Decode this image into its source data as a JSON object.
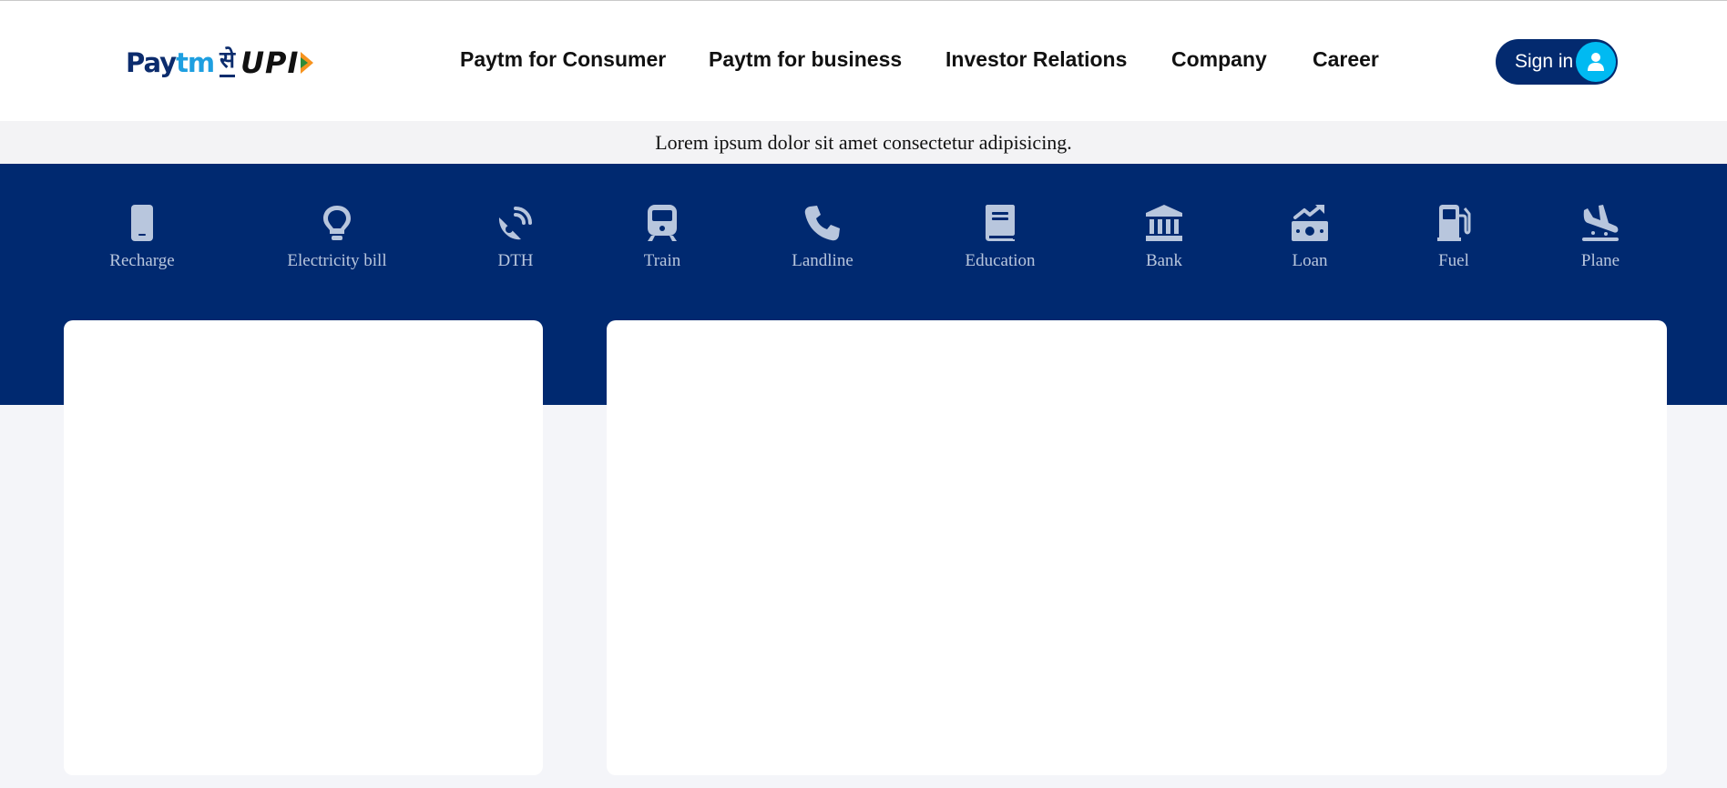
{
  "logo": {
    "paytm_pay": "Pay",
    "paytm_tm": "tm",
    "se": "से",
    "upi": "UPI",
    "colors": {
      "navy": "#0c2c6d",
      "sky": "#1e9fe0"
    }
  },
  "nav": {
    "items": [
      {
        "label": "Paytm for Consumer"
      },
      {
        "label": "Paytm for business"
      },
      {
        "label": "Investor Relations"
      },
      {
        "label": "Company"
      },
      {
        "label": "Career"
      }
    ],
    "signin_label": "Sign in"
  },
  "notice": {
    "text": "Lorem ipsum dolor sit amet consectetur adipisicing."
  },
  "services": {
    "items": [
      {
        "label": "Recharge",
        "icon": "mobile-icon"
      },
      {
        "label": "Electricity bill",
        "icon": "lightbulb-icon"
      },
      {
        "label": "DTH",
        "icon": "satellite-dish-icon"
      },
      {
        "label": "Train",
        "icon": "train-icon"
      },
      {
        "label": "Landline",
        "icon": "phone-icon"
      },
      {
        "label": "Education",
        "icon": "book-icon"
      },
      {
        "label": "Bank",
        "icon": "bank-icon"
      },
      {
        "label": "Loan",
        "icon": "money-bill-trend-icon"
      },
      {
        "label": "Fuel",
        "icon": "gas-pump-icon"
      },
      {
        "label": "Plane",
        "icon": "plane-landing-icon"
      }
    ]
  },
  "colors": {
    "brand_navy": "#002970",
    "signin_bg": "#032a6f",
    "avatar_bg": "#00baf2",
    "icon_color": "#b8c6dd",
    "page_bg": "#f4f5f9"
  }
}
